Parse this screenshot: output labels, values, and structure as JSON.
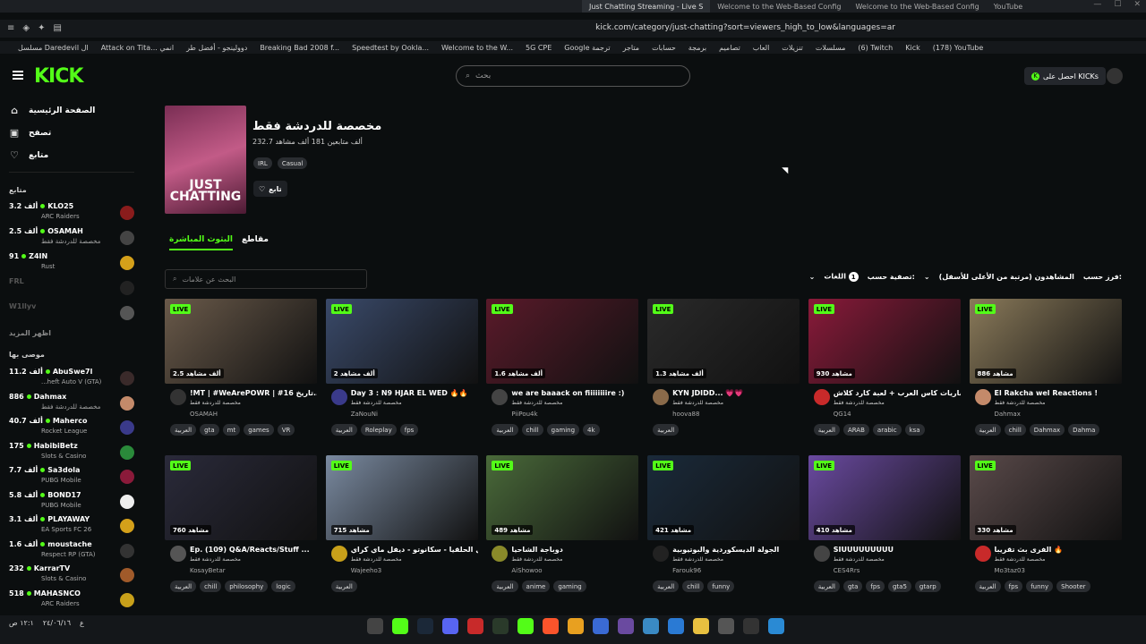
{
  "browser": {
    "tabs": [
      {
        "label": "Just Chatting Streaming - Live S",
        "active": true
      },
      {
        "label": "Welcome to the Web-Based Config"
      },
      {
        "label": "Welcome to the Web-Based Config"
      },
      {
        "label": "YouTube"
      }
    ],
    "url": "kick.com/category/just-chatting?sort=viewers_high_to_low&languages=ar",
    "bookmarks": [
      "مسلسل Daredevil ال",
      "Attack on Tita... انمي",
      "دوولينجو - أفضل طر",
      "Breaking Bad 2008 f...",
      "Speedtest by Ookla...",
      "Welcome to the W...",
      "5G CPE",
      "Google ترجمة",
      "متاجر",
      "حسابات",
      "برمجة",
      "تصاميم",
      "العاب",
      "تنزيلات",
      "مسلسلات",
      "(6) Twitch",
      "Kick",
      "(178) YouTube"
    ]
  },
  "header": {
    "logo": "KICK",
    "search_placeholder": "بحث",
    "get_kicks": "احصل على KICKs"
  },
  "sidebar": {
    "links": [
      {
        "label": "الصفحة الرئيسية",
        "icon": "home-icon"
      },
      {
        "label": "تصفح",
        "icon": "browse-icon"
      },
      {
        "label": "متابع",
        "icon": "heart-icon"
      }
    ],
    "following_heading": "متابع",
    "following": [
      {
        "name": "KLO25",
        "viewers": "3.2 ألف",
        "category": "ARC Raiders",
        "live": true,
        "color": "#8a1c1c"
      },
      {
        "name": "OSAMAH",
        "viewers": "2.5 ألف",
        "category": "مخصصة للدردشة فقط",
        "live": true,
        "color": "#444"
      },
      {
        "name": "Z4IN",
        "viewers": "91",
        "category": "Rust",
        "live": true,
        "color": "#d4a01a"
      },
      {
        "name": "FRL",
        "viewers": "",
        "category": "",
        "live": false,
        "color": "#222"
      },
      {
        "name": "W1llyv",
        "viewers": "",
        "category": "",
        "live": false,
        "color": "#555"
      }
    ],
    "show_more": "اظهر المزيد",
    "recommended_heading": "موصى بها",
    "recommended": [
      {
        "name": "AbuSwe7l",
        "viewers": "11.2 ألف",
        "category": "...heft Auto V (GTA)",
        "color": "#3a2a2a"
      },
      {
        "name": "Dahmax",
        "viewers": "886",
        "category": "مخصصة للدردشة فقط",
        "color": "#c48a6a"
      },
      {
        "name": "Maherco",
        "viewers": "40.7 ألف",
        "category": "Rocket League",
        "color": "#3a3a8a"
      },
      {
        "name": "HabibiBetz",
        "viewers": "175",
        "category": "Slots & Casino",
        "color": "#2a8a3a"
      },
      {
        "name": "Sa3dola",
        "viewers": "7.7 ألف",
        "category": "PUBG Mobile",
        "color": "#8a1a3a"
      },
      {
        "name": "BOND17",
        "viewers": "5.8 ألف",
        "category": "PUBG Mobile",
        "color": "#eee"
      },
      {
        "name": "PLAYAWAY",
        "viewers": "3.1 ألف",
        "category": "EA Sports FC 26",
        "color": "#d4a01a"
      },
      {
        "name": "moustache",
        "viewers": "1.6 ألف",
        "category": "Respect RP (GTA)",
        "color": "#333"
      },
      {
        "name": "KarrarTV",
        "viewers": "232",
        "category": "Slots & Casino",
        "color": "#a05a2a"
      },
      {
        "name": "MAHASNCO",
        "viewers": "518",
        "category": "ARC Raiders",
        "color": "#c8a01a"
      }
    ]
  },
  "category": {
    "cover_text": "JUST CHATTING",
    "title": "مخصصة للدردشة فقط",
    "stats": "232.7 ألف متابعين  181 ألف مشاهد",
    "tags": [
      "IRL",
      "Casual"
    ],
    "follow_label": "تابع"
  },
  "subtabs": [
    "البثوث المباشرة",
    "مقاطع"
  ],
  "tag_search_placeholder": "البحث عن علامات",
  "filters": {
    "sort_label": "فرز حسب:",
    "sort_value": "المشاهدون (مرتبة من الأعلى للأسفل)",
    "filter_label": "تصفية حسب:",
    "lang_label": "اللغات",
    "lang_count": "1"
  },
  "streams": [
    {
      "title": "!MT | #WeArePOWR | #16 تاريخ...",
      "user": "OSAMAH",
      "category": "مخصصة للدردشة فقط",
      "viewers": "2.5 ألف مشاهد",
      "tags": [
        "العربية",
        "gta",
        "mt",
        "games",
        "VR"
      ],
      "thumb": "#6a5a4a",
      "av": "#333"
    },
    {
      "title": "Day 3 : N9 HJAR EL WED 🔥🔥",
      "user": "ZaNouNi",
      "category": "مخصصة للدردشة فقط",
      "viewers": "2 ألف مشاهد",
      "tags": [
        "العربية",
        "Roleplay",
        "fps"
      ],
      "thumb": "#3a4a6a",
      "av": "#3a3a8a"
    },
    {
      "title": "we are baaack on fiiiiiiiire :)",
      "user": "PiiPou4k",
      "category": "مخصصة للدردشة فقط",
      "viewers": "1.6 ألف مشاهد",
      "tags": [
        "العربية",
        "chill",
        "gaming",
        "4k"
      ],
      "thumb": "#5a1a2a",
      "av": "#444"
    },
    {
      "title": "KYN JDIDD... 💗💗",
      "user": "hoova88",
      "category": "مخصصة للدردشة فقط",
      "viewers": "1.3 ألف مشاهد",
      "tags": [
        "العربية"
      ],
      "thumb": "#2a2a2a",
      "av": "#8a6a4a"
    },
    {
      "title": "مباريات كاس العرب + لعبة كارد كلاش",
      "user": "QG14",
      "category": "مخصصة للدردشة فقط",
      "viewers": "930 مشاهد",
      "tags": [
        "العربية",
        "ARAB",
        "arabic",
        "ksa"
      ],
      "thumb": "#8a1a3a",
      "av": "#c82a2a"
    },
    {
      "title": "El Rakcha wel Reactions !",
      "user": "Dahmax",
      "category": "مخصصة للدردشة فقط",
      "viewers": "886 مشاهد",
      "tags": [
        "العربية",
        "chill",
        "Dahmax",
        "Dahma"
      ],
      "thumb": "#8a7a5a",
      "av": "#c48a6a"
    },
    {
      "title": "Ep. (109) Q&A/Reacts/Stuff ...",
      "user": "KosayBetar",
      "category": "مخصصة للدردشة فقط",
      "viewers": "760 مشاهد",
      "tags": [
        "العربية",
        "chill",
        "philosophy",
        "logic"
      ],
      "thumb": "#2a2a3a",
      "av": "#555"
    },
    {
      "title": "تكمل الحلقيا - سكانوتو - ديفل ماي كراي",
      "user": "Wajeeho3",
      "category": "مخصصة للدردشة فقط",
      "viewers": "715 مشاهد",
      "tags": [
        "العربية"
      ],
      "thumb": "#7a8aa0",
      "av": "#c8a01a"
    },
    {
      "title": "دوباجة الشاحيا",
      "user": "AiShowoo",
      "category": "مخصصة للدردشة فقط",
      "viewers": "489 مشاهد",
      "tags": [
        "العربية",
        "anime",
        "gaming"
      ],
      "thumb": "#4a6a3a",
      "av": "#8a8a2a"
    },
    {
      "title": "الجولة الديسكوردية والبوتيوبية",
      "user": "Farouk96",
      "category": "مخصصة للدردشة فقط",
      "viewers": "421 مشاهد",
      "tags": [
        "العربية",
        "chill",
        "funny"
      ],
      "thumb": "#1a2a3a",
      "av": "#222"
    },
    {
      "title": "SIUUUUUUUUU",
      "user": "CES4Rrs",
      "category": "مخصصة للدردشة فقط",
      "viewers": "410 مشاهد",
      "tags": [
        "العربية",
        "gta",
        "fps",
        "gta5",
        "gtarp"
      ],
      "thumb": "#6a4aa0",
      "av": "#444"
    },
    {
      "title": "الفرى بث تقريباً 🔥",
      "user": "Mo3taz03",
      "category": "مخصصة للدردشة فقط",
      "viewers": "330 مشاهد",
      "tags": [
        "العربية",
        "fps",
        "funny",
        "Shooter"
      ],
      "thumb": "#5a4a4a",
      "av": "#c82a2a"
    }
  ],
  "live_label": "LIVE",
  "taskbar": {
    "time": "١٢:١ ص",
    "date": "٢٤/٠٦/١٦",
    "lang": "ع"
  }
}
